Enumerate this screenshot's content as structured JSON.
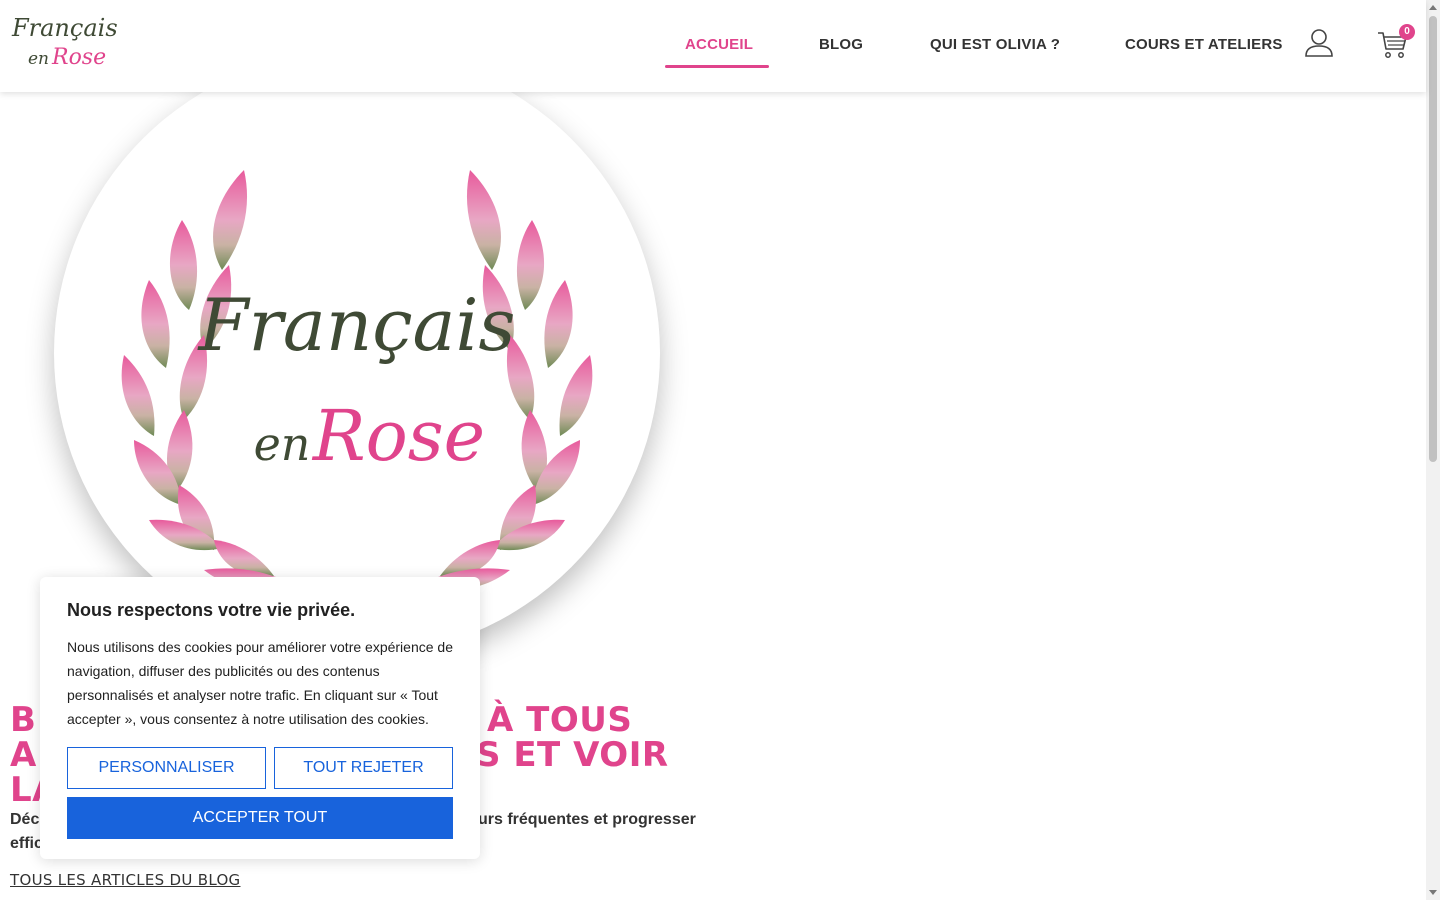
{
  "header": {
    "logo_line1": "Français",
    "logo_line2_a": "en",
    "logo_line2_b": "Rose",
    "nav": [
      {
        "label": "ACCUEIL",
        "active": true
      },
      {
        "label": "BLOG",
        "active": false
      },
      {
        "label": "QUI EST OLIVIA ?",
        "active": false
      },
      {
        "label": "COURS ET ATELIERS",
        "active": false
      }
    ],
    "cart_count": "0",
    "icons": [
      "user-icon",
      "cart-icon"
    ]
  },
  "hero": {
    "logo_line1": "Français",
    "logo_line2_a": "en",
    "logo_line2_b": "Rose",
    "title_line1_start": "B",
    "title_line1_end": "À TOUS",
    "title_line2_start": "A",
    "title_line2_end": "S ET VOIR",
    "title_line3_start": "LA",
    "intro_start": "Déco",
    "intro_end": "urs fréquentes et progresser",
    "intro_line2_start": "effic",
    "blog_link": "TOUS LES ARTICLES DU BLOG"
  },
  "cookie_banner": {
    "title": "Nous respectons votre vie privée.",
    "body": "Nous utilisons des cookies pour améliorer votre expérience de navigation, diffuser des publicités ou des contenus personnalisés et analyser notre trafic. En cliquant sur « Tout accepter », vous consentez à notre utilisation des cookies.",
    "customize_label": "PERSONNALISER",
    "reject_label": "TOUT REJETER",
    "accept_label": "ACCEPTER TOUT"
  },
  "colors": {
    "brand_pink": "#e0448c",
    "brand_green": "#3f4a35",
    "cookie_blue": "#1863dc"
  }
}
